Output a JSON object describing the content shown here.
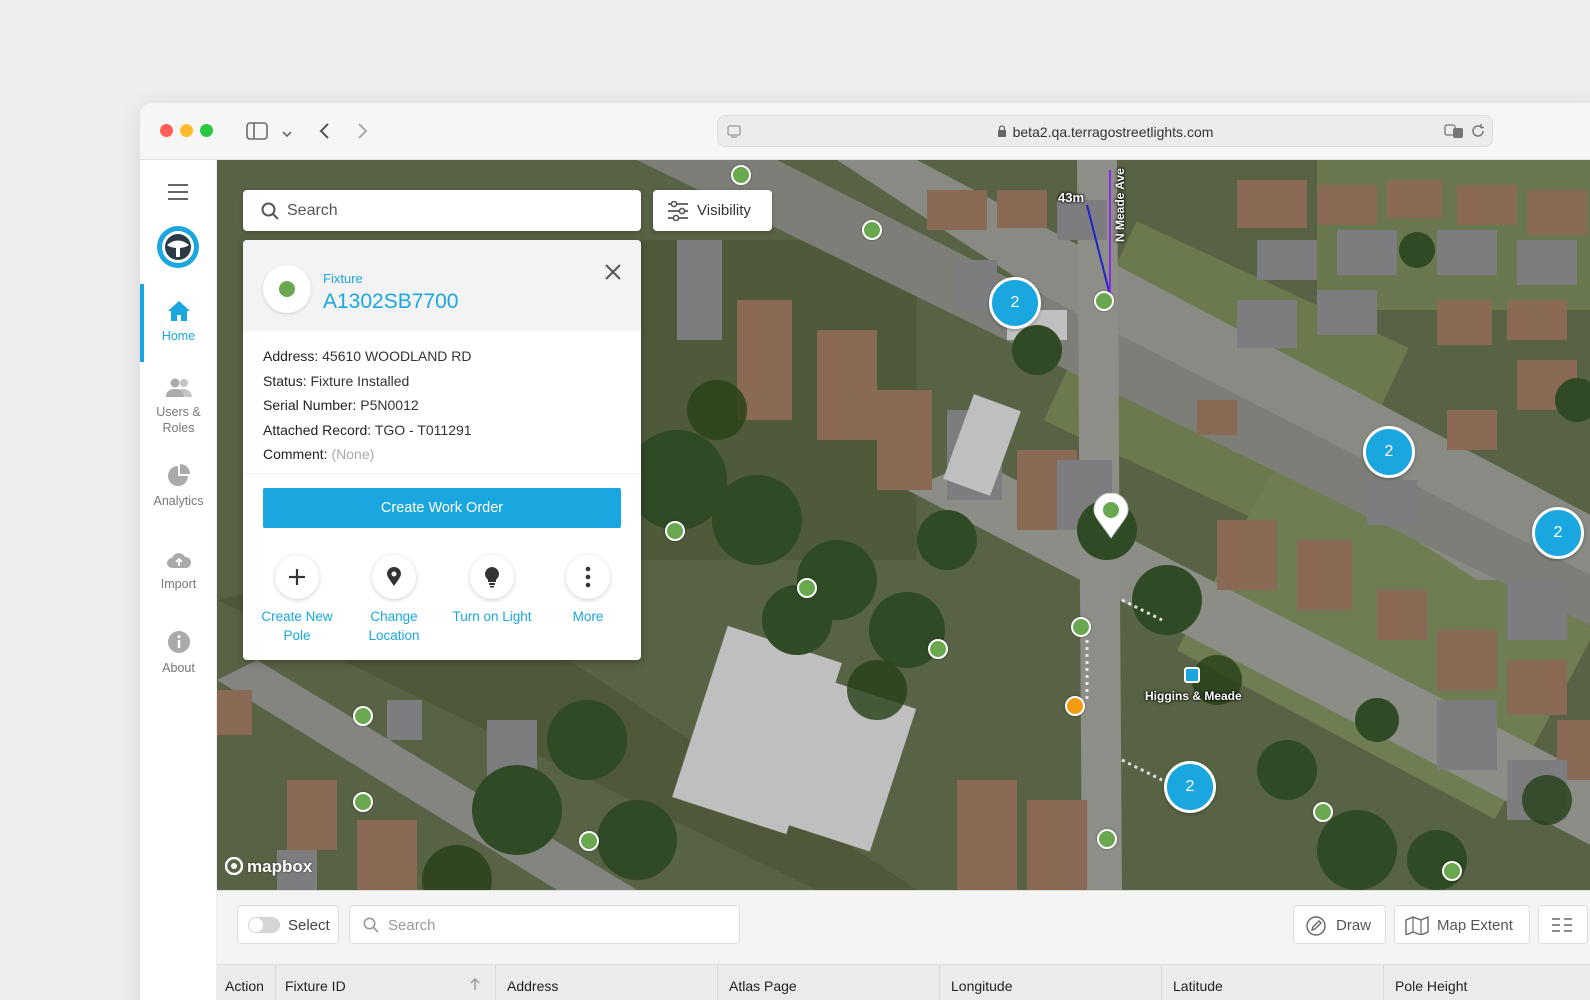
{
  "browser": {
    "url": "beta2.qa.terragostreetlights.com"
  },
  "sidebar": {
    "items": [
      {
        "label": "Home"
      },
      {
        "label": "Users & Roles"
      },
      {
        "label": "Analytics"
      },
      {
        "label": "Import"
      },
      {
        "label": "About"
      }
    ]
  },
  "map": {
    "search_placeholder": "Search",
    "visibility_label": "Visibility",
    "scale_label": "43m",
    "street_label": "N Meade Ave",
    "stop_label": "Higgins & Meade",
    "attribution": "mapbox",
    "clusters": [
      "2",
      "2",
      "2",
      "2"
    ]
  },
  "popup": {
    "kind": "Fixture",
    "fixture_id": "A1302SB7700",
    "address_label": "Address:",
    "address": "45610 WOODLAND RD",
    "status_label": "Status:",
    "status": "Fixture Installed",
    "serial_label": "Serial Number:",
    "serial": "P5N0012",
    "record_label": "Attached Record:",
    "record": "TGO - T011291",
    "comment_label": "Comment:",
    "comment": "(None)",
    "create_work_order": "Create Work Order",
    "actions": [
      {
        "label1": "Create New",
        "label2": "Pole"
      },
      {
        "label1": "Change",
        "label2": "Location"
      },
      {
        "label1": "Turn on Light",
        "label2": ""
      },
      {
        "label1": "More",
        "label2": ""
      }
    ]
  },
  "table": {
    "select_label": "Select",
    "search_placeholder": "Search",
    "draw_label": "Draw",
    "map_extent_label": "Map Extent",
    "columns": [
      "Action",
      "Fixture ID",
      "Address",
      "Atlas Page",
      "Longitude",
      "Latitude",
      "Pole Height"
    ]
  },
  "colors": {
    "accent": "#1aa7e0",
    "pin_green": "#6aa84f",
    "pin_orange": "#f39c12"
  }
}
